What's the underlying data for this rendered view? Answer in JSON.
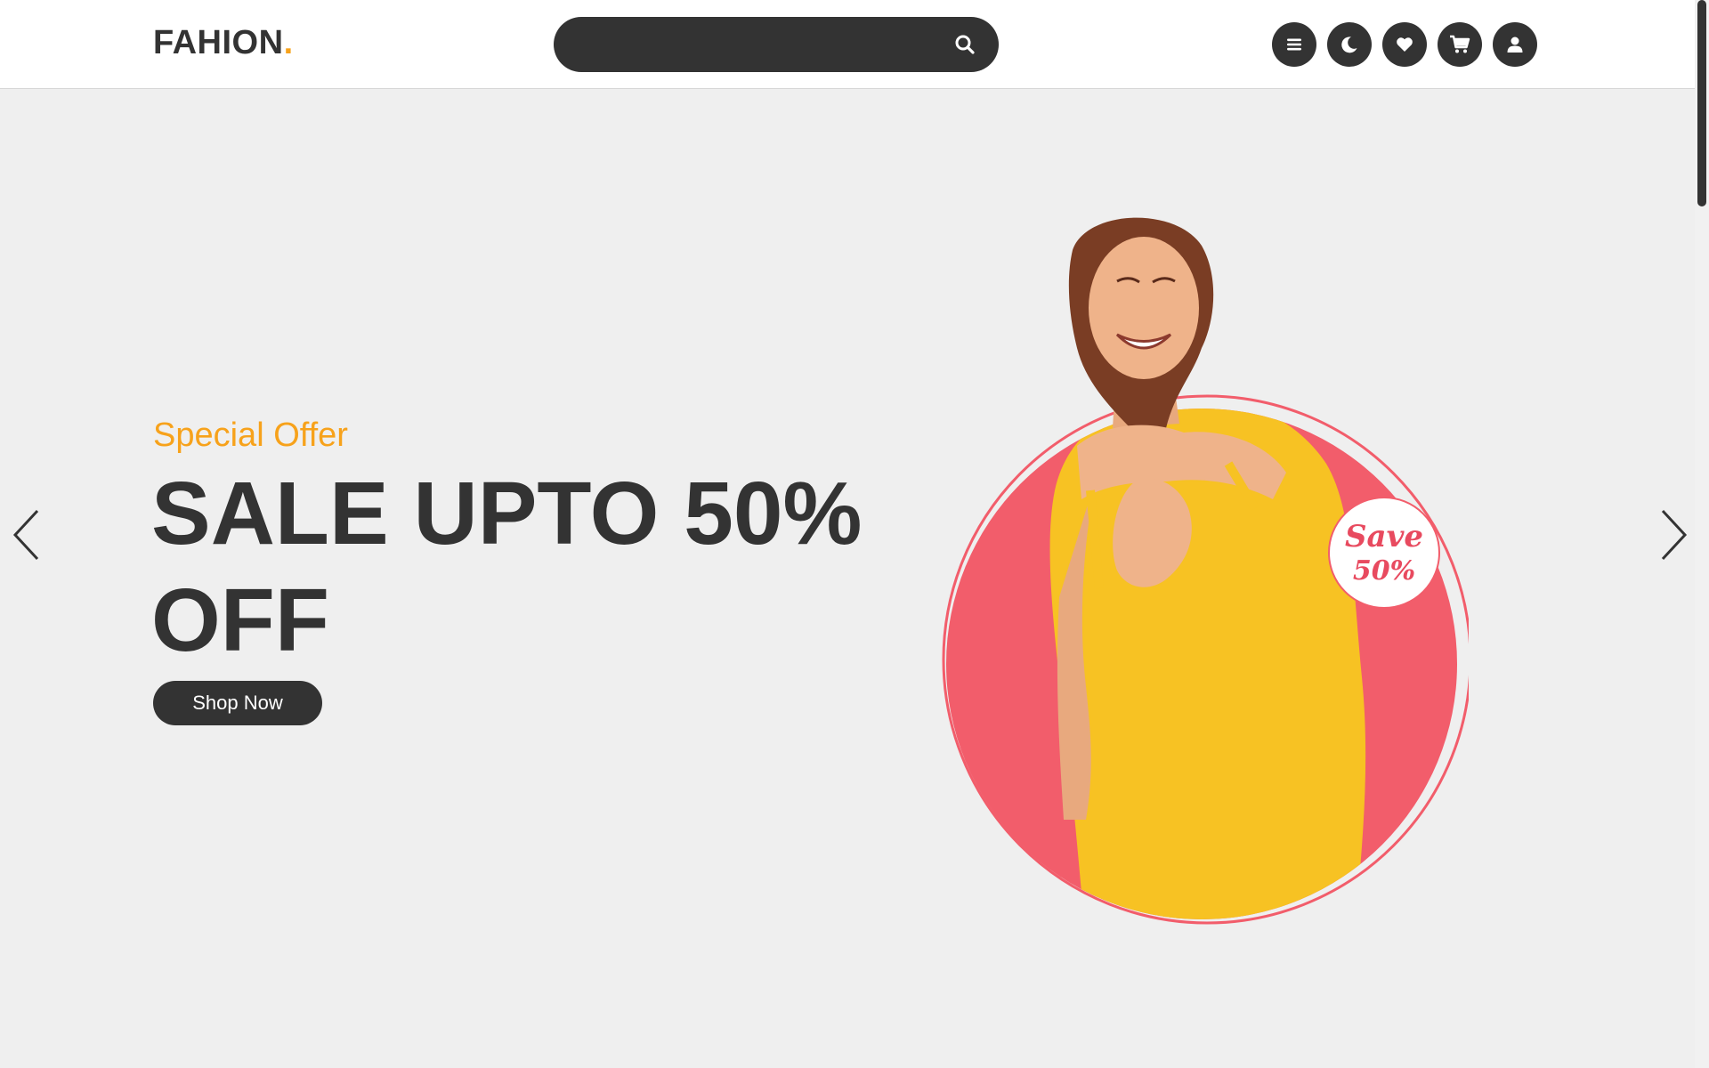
{
  "header": {
    "logo_text": "FAHION",
    "logo_dot": ".",
    "search": {
      "placeholder": "",
      "value": ""
    },
    "icons": [
      "menu-icon",
      "moon-icon",
      "heart-icon",
      "cart-icon",
      "user-icon"
    ]
  },
  "hero": {
    "subtitle": "Special Offer",
    "title": "SALE UPTO 50% OFF",
    "button_label": "Shop Now",
    "badge_line1": "Save",
    "badge_line2": "50%"
  },
  "colors": {
    "accent": "#f7a21b",
    "dark": "#333333",
    "background": "#efefef",
    "circle": "#f25d6b",
    "dress": "#f7c223"
  }
}
